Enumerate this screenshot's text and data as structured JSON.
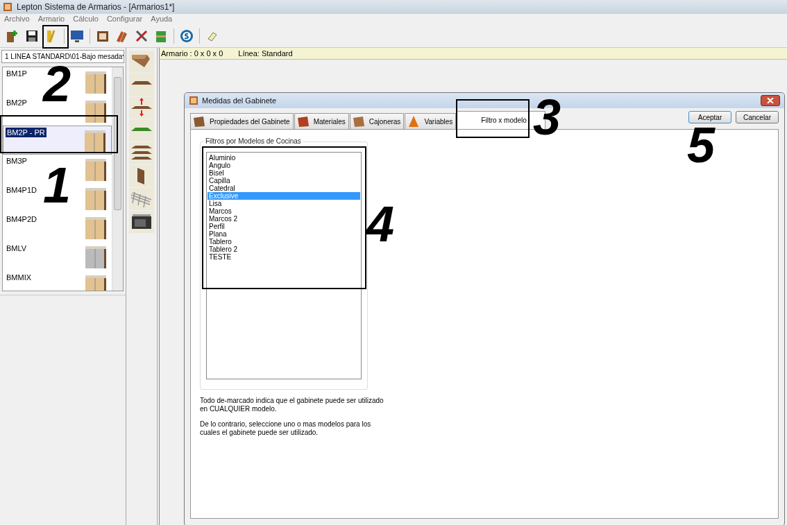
{
  "window": {
    "title": "Lepton Sistema de Armarios - [Armarios1*]"
  },
  "menu": [
    "Archivo",
    "Armario",
    "Cálculo",
    "Configurar",
    "Ayuda"
  ],
  "line_selector": {
    "value": "1 LINEA STANDARD\\01-Bajo mesada"
  },
  "cabinets": [
    {
      "name": "BM1P",
      "selected": false
    },
    {
      "name": "BM2P",
      "selected": false
    },
    {
      "name": "BM2P - PR",
      "selected": true
    },
    {
      "name": "BM3P",
      "selected": false
    },
    {
      "name": "BM4P1D",
      "selected": false
    },
    {
      "name": "BM4P2D",
      "selected": false
    },
    {
      "name": "BMLV",
      "selected": false
    },
    {
      "name": "BMMIX",
      "selected": false
    }
  ],
  "info_bar": {
    "armario": "Armario : 0 x 0 x 0",
    "linea": "Línea: Standard"
  },
  "dialog": {
    "title": "Medidas del Gabinete",
    "tabs": [
      {
        "label": "Propiedades del Gabinete",
        "selected": false
      },
      {
        "label": "Materiales",
        "selected": false
      },
      {
        "label": "Cajoneras",
        "selected": false
      },
      {
        "label": "Variables",
        "selected": false
      },
      {
        "label": "Filtro x modelo",
        "selected": true
      }
    ],
    "buttons": [
      "Aceptar",
      "Cancelar"
    ],
    "group_title": "Filtros por Modelos de Cocinas",
    "models": [
      {
        "label": "Aluminio",
        "selected": false
      },
      {
        "label": "Angulo",
        "selected": false
      },
      {
        "label": "Bisel",
        "selected": false
      },
      {
        "label": "Capilla",
        "selected": false
      },
      {
        "label": "Catedral",
        "selected": false
      },
      {
        "label": "Exclusive",
        "selected": true
      },
      {
        "label": "Lisa",
        "selected": false
      },
      {
        "label": "Marcos",
        "selected": false
      },
      {
        "label": "Marcos 2",
        "selected": false
      },
      {
        "label": "Perfil",
        "selected": false
      },
      {
        "label": "Plana",
        "selected": false
      },
      {
        "label": "Tablero",
        "selected": false
      },
      {
        "label": "Tablero 2",
        "selected": false
      },
      {
        "label": "TESTE",
        "selected": false
      }
    ],
    "note_1": "Todo de-marcado indica que el gabinete puede ser utilizado en CUALQUIER modelo.",
    "note_2": "De lo contrario, seleccione uno o mas modelos para los cuales el gabinete puede ser utilizado."
  },
  "annotations": [
    {
      "label": "1"
    },
    {
      "label": "2"
    },
    {
      "label": "3"
    },
    {
      "label": "4"
    },
    {
      "label": "5"
    }
  ]
}
